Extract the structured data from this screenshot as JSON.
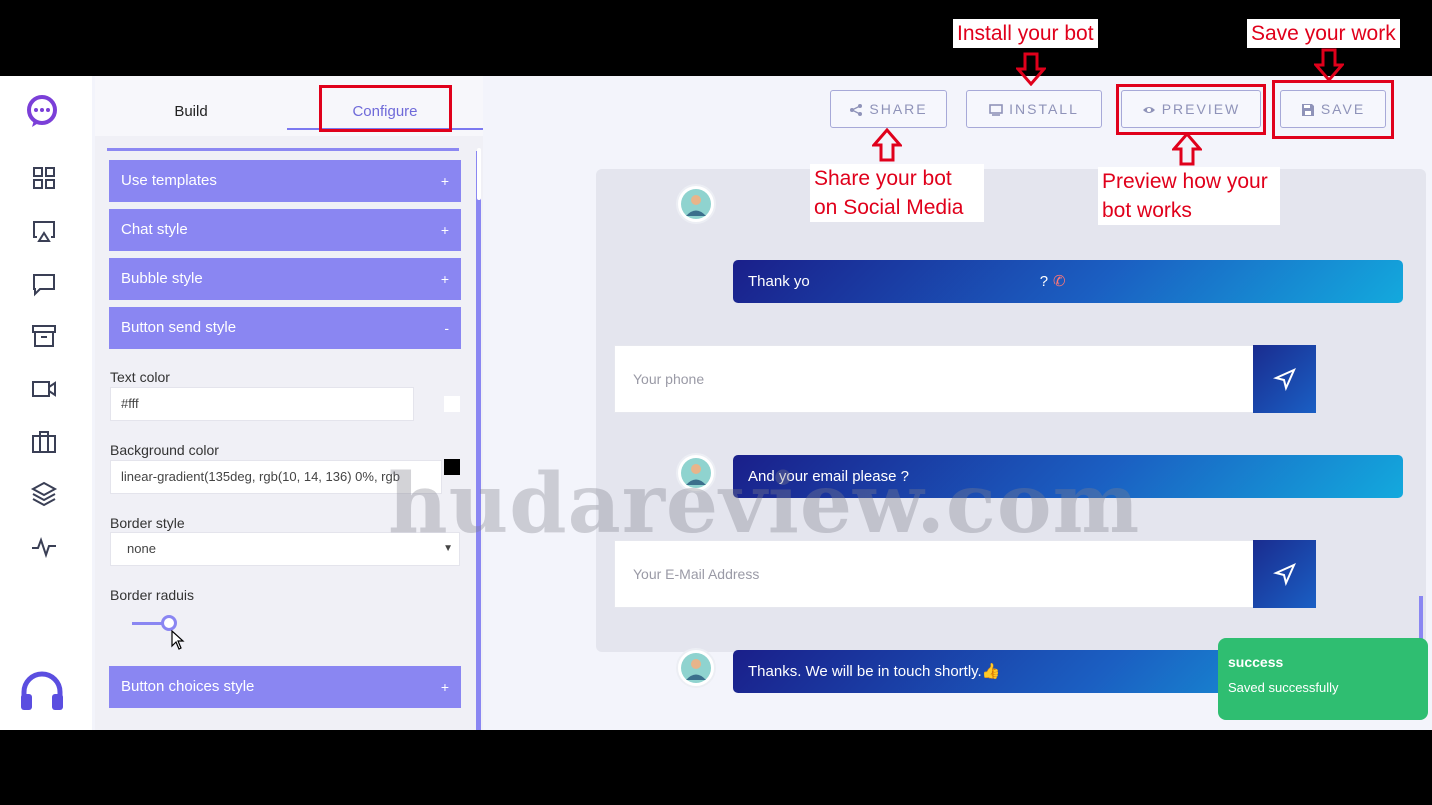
{
  "panel": {
    "tabs": {
      "build": "Build",
      "configure": "Configure"
    },
    "sections": {
      "use_templates": "Use templates",
      "chat_style": "Chat style",
      "bubble_style": "Bubble style",
      "button_send_style": "Button send style",
      "button_choices_style": "Button choices style",
      "expand": "+",
      "collapse": "-"
    },
    "fields": {
      "text_color_label": "Text color",
      "text_color_value": "#fff",
      "background_color_label": "Background color",
      "background_color_value": "linear-gradient(135deg, rgb(10, 14, 136) 0%, rgb",
      "border_style_label": "Border style",
      "border_style_value": "none",
      "border_radius_label": "Border raduis"
    }
  },
  "toolbar": {
    "share": "SHARE",
    "install": "INSTALL",
    "preview": "PREVIEW",
    "save": "SAVE"
  },
  "chat": {
    "bubble1": "Thank yo",
    "bubble1_tail": "?",
    "phone_placeholder": "Your phone",
    "bubble2": "And your email please ?",
    "email_placeholder": "Your E-Mail Address",
    "bubble3": "Thanks. We will be in touch shortly.👍"
  },
  "toast": {
    "title": "success",
    "message": "Saved successfully"
  },
  "watermark": "hudareview.com",
  "annotations": {
    "install": "Install your bot",
    "save": "Save your work",
    "share_line1": "Share your bot",
    "share_line2": "on Social Media",
    "preview_line1": "Preview how your",
    "preview_line2": "bot works"
  },
  "colors": {
    "accent": "#8a86f2",
    "annotation": "#e0001b",
    "toast": "#2fbe71",
    "swatch_text": "#ffffff",
    "swatch_bg": "#000000"
  }
}
